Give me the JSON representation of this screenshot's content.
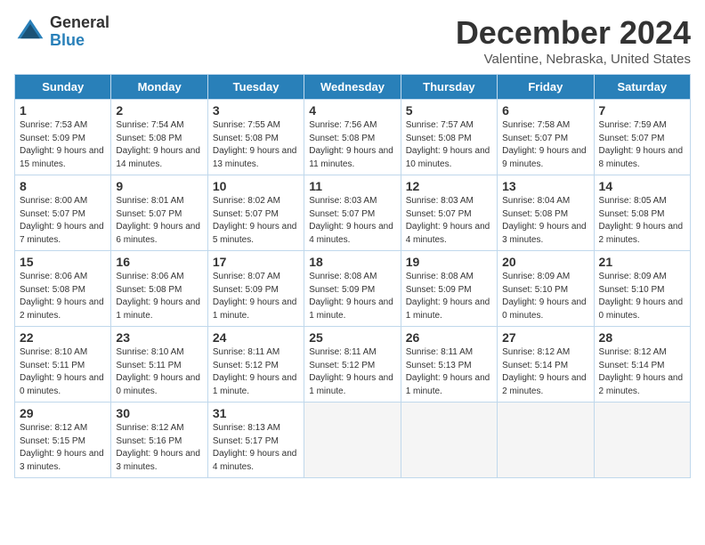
{
  "header": {
    "logo_general": "General",
    "logo_blue": "Blue",
    "title": "December 2024",
    "subtitle": "Valentine, Nebraska, United States"
  },
  "days_of_week": [
    "Sunday",
    "Monday",
    "Tuesday",
    "Wednesday",
    "Thursday",
    "Friday",
    "Saturday"
  ],
  "weeks": [
    [
      {
        "num": "1",
        "sunrise": "7:53 AM",
        "sunset": "5:09 PM",
        "daylight": "9 hours and 15 minutes."
      },
      {
        "num": "2",
        "sunrise": "7:54 AM",
        "sunset": "5:08 PM",
        "daylight": "9 hours and 14 minutes."
      },
      {
        "num": "3",
        "sunrise": "7:55 AM",
        "sunset": "5:08 PM",
        "daylight": "9 hours and 13 minutes."
      },
      {
        "num": "4",
        "sunrise": "7:56 AM",
        "sunset": "5:08 PM",
        "daylight": "9 hours and 11 minutes."
      },
      {
        "num": "5",
        "sunrise": "7:57 AM",
        "sunset": "5:08 PM",
        "daylight": "9 hours and 10 minutes."
      },
      {
        "num": "6",
        "sunrise": "7:58 AM",
        "sunset": "5:07 PM",
        "daylight": "9 hours and 9 minutes."
      },
      {
        "num": "7",
        "sunrise": "7:59 AM",
        "sunset": "5:07 PM",
        "daylight": "9 hours and 8 minutes."
      }
    ],
    [
      {
        "num": "8",
        "sunrise": "8:00 AM",
        "sunset": "5:07 PM",
        "daylight": "9 hours and 7 minutes."
      },
      {
        "num": "9",
        "sunrise": "8:01 AM",
        "sunset": "5:07 PM",
        "daylight": "9 hours and 6 minutes."
      },
      {
        "num": "10",
        "sunrise": "8:02 AM",
        "sunset": "5:07 PM",
        "daylight": "9 hours and 5 minutes."
      },
      {
        "num": "11",
        "sunrise": "8:03 AM",
        "sunset": "5:07 PM",
        "daylight": "9 hours and 4 minutes."
      },
      {
        "num": "12",
        "sunrise": "8:03 AM",
        "sunset": "5:07 PM",
        "daylight": "9 hours and 4 minutes."
      },
      {
        "num": "13",
        "sunrise": "8:04 AM",
        "sunset": "5:08 PM",
        "daylight": "9 hours and 3 minutes."
      },
      {
        "num": "14",
        "sunrise": "8:05 AM",
        "sunset": "5:08 PM",
        "daylight": "9 hours and 2 minutes."
      }
    ],
    [
      {
        "num": "15",
        "sunrise": "8:06 AM",
        "sunset": "5:08 PM",
        "daylight": "9 hours and 2 minutes."
      },
      {
        "num": "16",
        "sunrise": "8:06 AM",
        "sunset": "5:08 PM",
        "daylight": "9 hours and 1 minute."
      },
      {
        "num": "17",
        "sunrise": "8:07 AM",
        "sunset": "5:09 PM",
        "daylight": "9 hours and 1 minute."
      },
      {
        "num": "18",
        "sunrise": "8:08 AM",
        "sunset": "5:09 PM",
        "daylight": "9 hours and 1 minute."
      },
      {
        "num": "19",
        "sunrise": "8:08 AM",
        "sunset": "5:09 PM",
        "daylight": "9 hours and 1 minute."
      },
      {
        "num": "20",
        "sunrise": "8:09 AM",
        "sunset": "5:10 PM",
        "daylight": "9 hours and 0 minutes."
      },
      {
        "num": "21",
        "sunrise": "8:09 AM",
        "sunset": "5:10 PM",
        "daylight": "9 hours and 0 minutes."
      }
    ],
    [
      {
        "num": "22",
        "sunrise": "8:10 AM",
        "sunset": "5:11 PM",
        "daylight": "9 hours and 0 minutes."
      },
      {
        "num": "23",
        "sunrise": "8:10 AM",
        "sunset": "5:11 PM",
        "daylight": "9 hours and 0 minutes."
      },
      {
        "num": "24",
        "sunrise": "8:11 AM",
        "sunset": "5:12 PM",
        "daylight": "9 hours and 1 minute."
      },
      {
        "num": "25",
        "sunrise": "8:11 AM",
        "sunset": "5:12 PM",
        "daylight": "9 hours and 1 minute."
      },
      {
        "num": "26",
        "sunrise": "8:11 AM",
        "sunset": "5:13 PM",
        "daylight": "9 hours and 1 minute."
      },
      {
        "num": "27",
        "sunrise": "8:12 AM",
        "sunset": "5:14 PM",
        "daylight": "9 hours and 2 minutes."
      },
      {
        "num": "28",
        "sunrise": "8:12 AM",
        "sunset": "5:14 PM",
        "daylight": "9 hours and 2 minutes."
      }
    ],
    [
      {
        "num": "29",
        "sunrise": "8:12 AM",
        "sunset": "5:15 PM",
        "daylight": "9 hours and 3 minutes."
      },
      {
        "num": "30",
        "sunrise": "8:12 AM",
        "sunset": "5:16 PM",
        "daylight": "9 hours and 3 minutes."
      },
      {
        "num": "31",
        "sunrise": "8:13 AM",
        "sunset": "5:17 PM",
        "daylight": "9 hours and 4 minutes."
      },
      null,
      null,
      null,
      null
    ]
  ],
  "labels": {
    "sunrise": "Sunrise: ",
    "sunset": "Sunset: ",
    "daylight": "Daylight: "
  }
}
